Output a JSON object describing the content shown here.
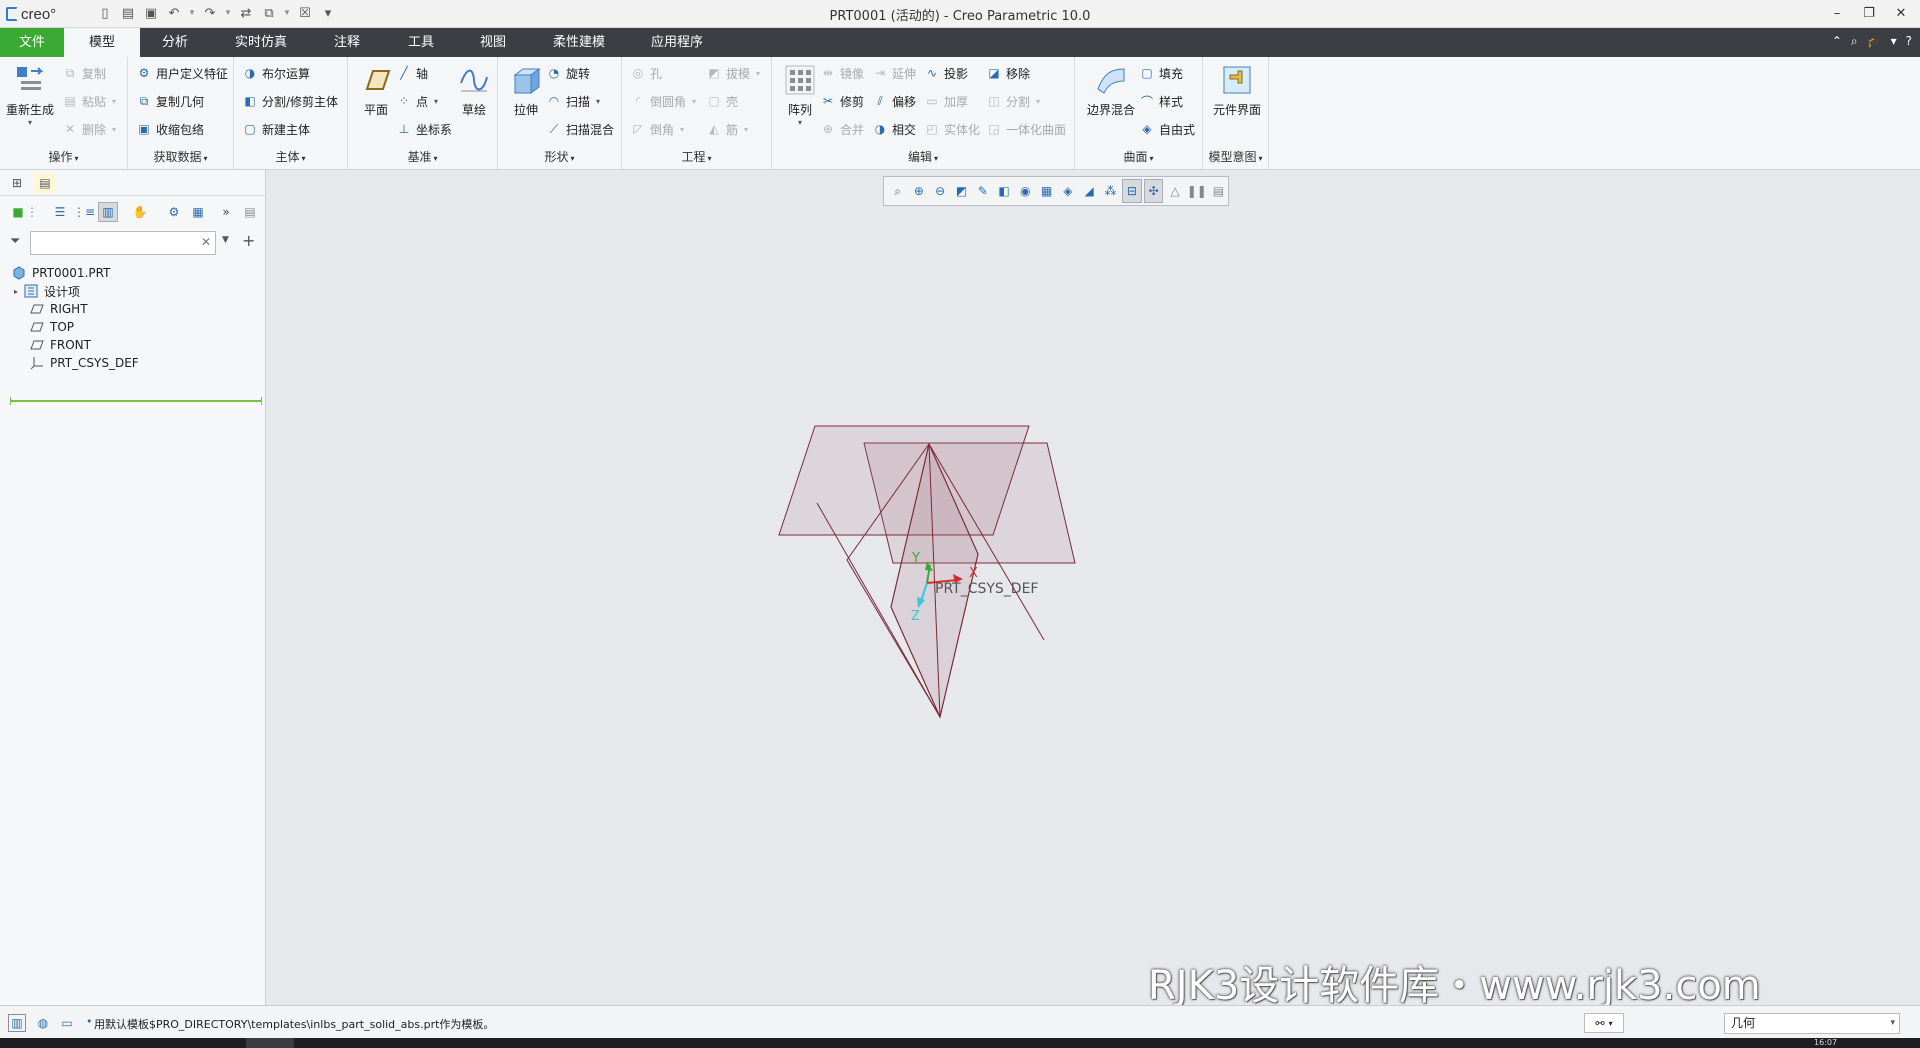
{
  "app": {
    "logo_text": "creo°",
    "window_title": "PRT0001 (活动的) - Creo Parametric 10.0"
  },
  "quick_access": [
    "new-icon",
    "open-icon",
    "save-icon",
    "undo-icon",
    "redo-icon",
    "regenerate-icon",
    "switch-window-icon",
    "close-window-icon",
    "customize-icon"
  ],
  "tabs": [
    {
      "label": "文件",
      "kind": "file"
    },
    {
      "label": "模型",
      "kind": "active"
    },
    {
      "label": "分析"
    },
    {
      "label": "实时仿真"
    },
    {
      "label": "注释"
    },
    {
      "label": "工具"
    },
    {
      "label": "视图"
    },
    {
      "label": "柔性建模"
    },
    {
      "label": "应用程序"
    }
  ],
  "ribbon": {
    "operations": {
      "label": "操作",
      "regenerate": "重新生成",
      "copy": "复制",
      "paste": "粘贴",
      "delete": "删除"
    },
    "get_data": {
      "label": "获取数据",
      "udf": "用户定义特征",
      "copy_geom": "复制几何",
      "shrinkwrap": "收缩包络"
    },
    "body": {
      "label": "主体",
      "boolean": "布尔运算",
      "split": "分割/修剪主体",
      "new_body": "新建主体"
    },
    "datum": {
      "label": "基准",
      "plane": "平面",
      "axis": "轴",
      "point": "点",
      "csys": "坐标系",
      "sketch": "草绘"
    },
    "shapes": {
      "label": "形状",
      "extrude": "拉伸",
      "revolve": "旋转",
      "sweep": "扫描",
      "swept_blend": "扫描混合"
    },
    "engineering": {
      "label": "工程",
      "hole": "孔",
      "round": "倒圆角",
      "chamfer": "倒角",
      "draft": "拔模",
      "shell": "壳",
      "rib": "筋"
    },
    "editing": {
      "label": "编辑",
      "pattern": "阵列",
      "mirror": "镜像",
      "extend": "延伸",
      "project": "投影",
      "remove": "移除",
      "trim": "修剪",
      "offset": "偏移",
      "thicken": "加厚",
      "split": "分割",
      "merge": "合并",
      "intersect": "相交",
      "solidify": "实体化",
      "unify": "一体化曲面"
    },
    "surfaces": {
      "label": "曲面",
      "boundary_blend": "边界混合",
      "fill": "填充",
      "style": "样式",
      "freestyle": "自由式"
    },
    "model_intent": {
      "label": "模型意图",
      "component_interface": "元件界面"
    }
  },
  "model_tree": {
    "search_placeholder": "",
    "root": "PRT0001.PRT",
    "items": [
      {
        "label": "设计项",
        "icon": "design-items-icon",
        "expandable": true
      },
      {
        "label": "RIGHT",
        "icon": "datum-plane-icon"
      },
      {
        "label": "TOP",
        "icon": "datum-plane-icon"
      },
      {
        "label": "FRONT",
        "icon": "datum-plane-icon"
      },
      {
        "label": "PRT_CSYS_DEF",
        "icon": "csys-icon"
      }
    ]
  },
  "graphics": {
    "csys_label": "PRT_CSYS_DEF",
    "axis_x": "X",
    "axis_y": "Y",
    "axis_z": "Z",
    "plane_color": "#7a2a36",
    "toolbar": [
      "refit-icon",
      "zoom-in-icon",
      "zoom-out-icon",
      "repaint-icon",
      "perspective-icon",
      "display-style-icon",
      "saved-orientations-icon",
      "view-manager-icon",
      "named-views-icon",
      "section-icon",
      "datum-display-icon",
      "annotation-display-icon",
      "spin-center-icon",
      "appearance-icon",
      "pause-icon",
      "slider-icon"
    ]
  },
  "watermark": "RJK3设计软件库・www.rjk3.com",
  "status": {
    "message": "用默认模板$PRO_DIRECTORY\\templates\\inlbs_part_solid_abs.prt作为模板。",
    "selection_filter": "几何"
  },
  "clock": "16:07"
}
